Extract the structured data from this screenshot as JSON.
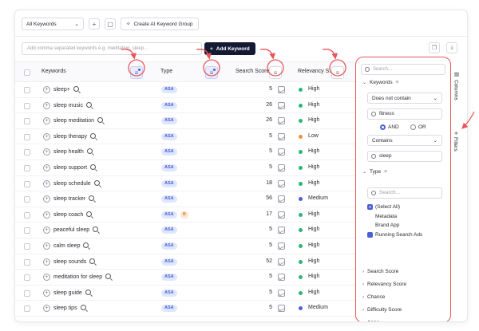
{
  "toolbar": {
    "keyword_select": "All Keywords",
    "create_ai_group": "Create AI Keyword Group"
  },
  "keyword_input": {
    "placeholder": "Add comma separated keywords e.g. meditation, sleep...",
    "add_button": "Add Keyword"
  },
  "columns": {
    "keywords": "Keywords",
    "type": "Type",
    "search_score": "Search Score",
    "relevancy": "Relevancy S..."
  },
  "rows": [
    {
      "keyword": "sleep+",
      "type": "ASA",
      "extra": "",
      "score": "5",
      "relevancy": "High",
      "color": "#2bb673"
    },
    {
      "keyword": "sleep music",
      "type": "ASA",
      "extra": "",
      "score": "26",
      "relevancy": "High",
      "color": "#2bb673"
    },
    {
      "keyword": "sleep meditation",
      "type": "ASA",
      "extra": "",
      "score": "26",
      "relevancy": "High",
      "color": "#2bb673"
    },
    {
      "keyword": "sleep therapy",
      "type": "ASA",
      "extra": "",
      "score": "5",
      "relevancy": "Low",
      "color": "#f0913a"
    },
    {
      "keyword": "sleep health",
      "type": "ASA",
      "extra": "",
      "score": "5",
      "relevancy": "High",
      "color": "#2bb673"
    },
    {
      "keyword": "sleep support",
      "type": "ASA",
      "extra": "",
      "score": "5",
      "relevancy": "High",
      "color": "#2bb673"
    },
    {
      "keyword": "sleep schedule",
      "type": "ASA",
      "extra": "",
      "score": "18",
      "relevancy": "High",
      "color": "#2bb673"
    },
    {
      "keyword": "sleep tracker",
      "type": "ASA",
      "extra": "",
      "score": "56",
      "relevancy": "Medium",
      "color": "#4b5fd6"
    },
    {
      "keyword": "sleep coach",
      "type": "ASA",
      "extra": "B",
      "score": "17",
      "relevancy": "High",
      "color": "#2bb673"
    },
    {
      "keyword": "peaceful sleep",
      "type": "ASA",
      "extra": "",
      "score": "5",
      "relevancy": "High",
      "color": "#2bb673"
    },
    {
      "keyword": "calm sleep",
      "type": "ASA",
      "extra": "",
      "score": "5",
      "relevancy": "High",
      "color": "#2bb673"
    },
    {
      "keyword": "sleep sounds",
      "type": "ASA",
      "extra": "",
      "score": "52",
      "relevancy": "High",
      "color": "#2bb673"
    },
    {
      "keyword": "meditation for sleep",
      "type": "ASA",
      "extra": "",
      "score": "5",
      "relevancy": "High",
      "color": "#2bb673"
    },
    {
      "keyword": "sleep guide",
      "type": "ASA",
      "extra": "",
      "score": "5",
      "relevancy": "High",
      "color": "#2bb673"
    },
    {
      "keyword": "sleep tips",
      "type": "ASA",
      "extra": "",
      "score": "5",
      "relevancy": "Medium",
      "color": "#4b5fd6"
    }
  ],
  "panel": {
    "search_placeholder": "Search...",
    "keywords_section": "Keywords",
    "condition1": "Does not contain",
    "value1": "fitness",
    "and_label": "AND",
    "or_label": "OR",
    "condition2": "Contains",
    "value2": "sleep",
    "type_section": "Type",
    "type_search_placeholder": "Search...",
    "type_options": [
      {
        "label": "(Select All)",
        "state": "partial"
      },
      {
        "label": "Metadata",
        "state": "off"
      },
      {
        "label": "Brand App",
        "state": "off"
      },
      {
        "label": "Running Search Ads",
        "state": "on"
      }
    ],
    "collapsed": [
      "Search Score",
      "Relevancy Score",
      "Chance",
      "Difficulty Score",
      "Apps"
    ]
  },
  "side_tabs": {
    "columns": "Columns",
    "filters": "Filters"
  },
  "colors": {
    "accent": "#4b5fd6",
    "annotation": "#e8565a",
    "dark_button": "#141a33"
  }
}
